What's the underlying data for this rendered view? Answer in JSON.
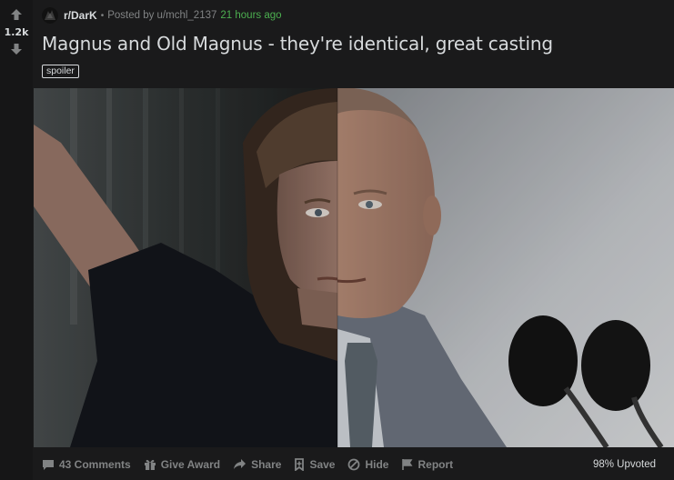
{
  "votes": {
    "score": "1.2k",
    "upvote_icon": "arrow-up-icon",
    "downvote_icon": "arrow-down-icon"
  },
  "header": {
    "subreddit": "r/DarK",
    "separator": "•",
    "posted_by": "Posted by u/mchl_2137",
    "time": "21 hours ago"
  },
  "post": {
    "title": "Magnus and Old Magnus - they're identical, great casting",
    "flair": "spoiler"
  },
  "footer": {
    "comments": "43 Comments",
    "give_award": "Give Award",
    "share": "Share",
    "save": "Save",
    "hide": "Hide",
    "report": "Report",
    "upvoted": "98% Upvoted"
  },
  "colors": {
    "background": "#1a1a1b",
    "vote_column": "#161617",
    "text": "#d7dadc",
    "muted": "#818384",
    "time_green": "#4caf50"
  }
}
